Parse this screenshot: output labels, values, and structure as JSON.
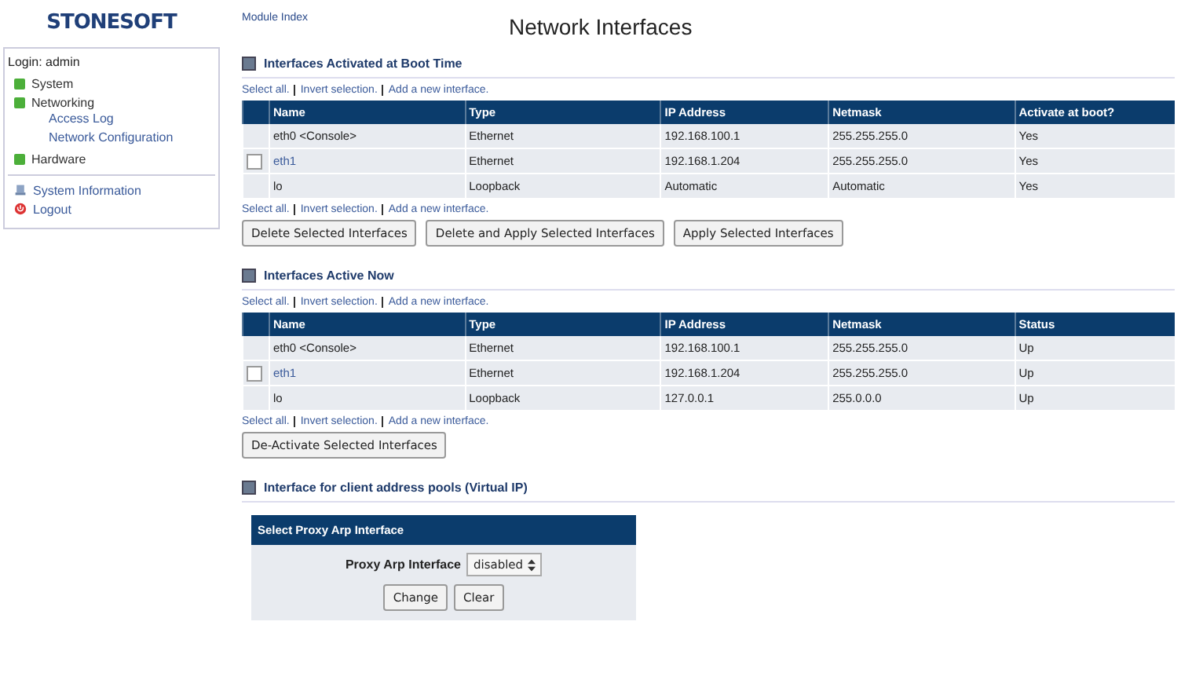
{
  "logo": "STONESOFT",
  "sidebar": {
    "login": "Login: admin",
    "items": [
      {
        "label": "System",
        "kind": "section"
      },
      {
        "label": "Networking",
        "kind": "section",
        "children": [
          {
            "label": "Access Log"
          },
          {
            "label": "Network Configuration"
          }
        ]
      },
      {
        "label": "Hardware",
        "kind": "section"
      },
      {
        "label": "System Information",
        "kind": "info"
      },
      {
        "label": "Logout",
        "kind": "logout"
      }
    ]
  },
  "module_link": "Module Index",
  "page_title": "Network Interfaces",
  "sections": [
    {
      "title": "Interfaces Activated at Boot Time",
      "links_top": [
        "Select all.",
        "Invert selection.",
        "Add a new interface."
      ],
      "columns": [
        "Name",
        "Type",
        "IP Address",
        "Netmask",
        "Activate at boot?"
      ],
      "rows": [
        {
          "kind": "fixed",
          "cells": [
            "eth0 <Console>",
            "Ethernet",
            "192.168.100.1",
            "255.255.255.0",
            "Yes"
          ]
        },
        {
          "kind": "selectable",
          "checked": false,
          "cells": [
            "eth1",
            "Ethernet",
            "192.168.1.204",
            "255.255.255.0",
            "Yes"
          ]
        },
        {
          "kind": "fixed",
          "cells": [
            "lo",
            "Loopback",
            "Automatic",
            "Automatic",
            "Yes"
          ]
        }
      ],
      "links_bottom": [
        "Select all.",
        "Invert selection.",
        "Add a new interface."
      ],
      "buttons": [
        "Delete Selected Interfaces",
        "Delete and Apply Selected Interfaces",
        "Apply Selected Interfaces"
      ]
    },
    {
      "title": "Interfaces Active Now",
      "links_top": [
        "Select all.",
        "Invert selection.",
        "Add a new interface."
      ],
      "columns": [
        "Name",
        "Type",
        "IP Address",
        "Netmask",
        "Status"
      ],
      "rows": [
        {
          "kind": "fixed",
          "cells": [
            "eth0 <Console>",
            "Ethernet",
            "192.168.100.1",
            "255.255.255.0",
            "Up"
          ]
        },
        {
          "kind": "selectable",
          "checked": false,
          "cells": [
            "eth1",
            "Ethernet",
            "192.168.1.204",
            "255.255.255.0",
            "Up"
          ]
        },
        {
          "kind": "fixed",
          "cells": [
            "lo",
            "Loopback",
            "127.0.0.1",
            "255.0.0.0",
            "Up"
          ]
        }
      ],
      "links_bottom": [
        "Select all.",
        "Invert selection.",
        "Add a new interface."
      ],
      "buttons": [
        "De-Activate Selected Interfaces"
      ]
    }
  ],
  "proxy": {
    "title": "Interface for client address pools (Virtual IP)",
    "box_title": "Select Proxy Arp Interface",
    "label": "Proxy Arp Interface",
    "value": "disabled",
    "buttons": [
      "Change",
      "Clear"
    ]
  }
}
